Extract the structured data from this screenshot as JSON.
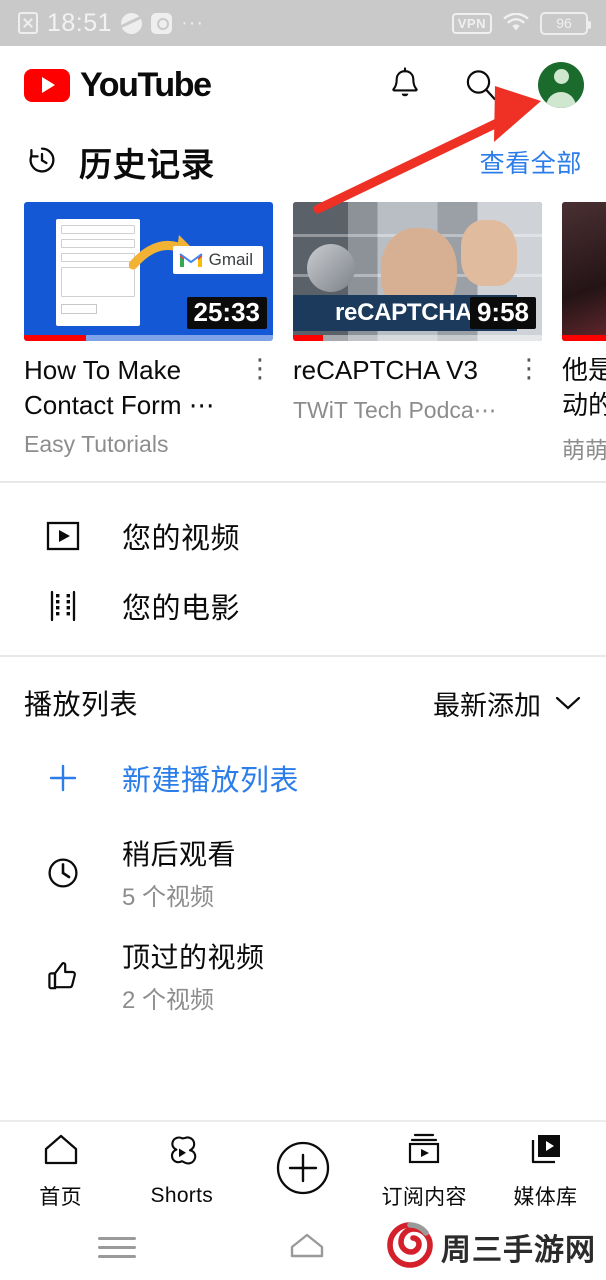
{
  "statusbar": {
    "time": "18:51",
    "close_icon": "close-icon",
    "app_icons": [
      "browser-app-icon",
      "tiktok-app-icon"
    ],
    "overflow": "···",
    "vpn_label": "VPN",
    "wifi_icon": "wifi-icon",
    "battery_level": "96"
  },
  "header": {
    "brand": "YouTube",
    "notifications_icon": "bell-icon",
    "search_icon": "search-icon",
    "avatar": "account-avatar",
    "avatar_color": "#1b6b2c"
  },
  "history": {
    "title": "历史记录",
    "clock_icon": "history-clock-icon",
    "view_all": "查看全部",
    "view_all_color": "#2b7de9",
    "videos": [
      {
        "title": "How To Make Contact Form ⋯",
        "channel": "Easy Tutorials",
        "duration": "25:33",
        "progress_percent": 25,
        "thumb_label": "Gmail",
        "menu_icon": "kebab-menu-icon"
      },
      {
        "title": "reCAPTCHA V3",
        "channel": "TWiT Tech Podca⋯",
        "duration": "9:58",
        "progress_percent": 12,
        "thumb_label": "reCAPTCHA V3",
        "menu_icon": "kebab-menu-icon"
      },
      {
        "title": "他是\n动的",
        "channel": "萌萌",
        "duration": "",
        "progress_percent": 100,
        "thumb_label": "",
        "menu_icon": "kebab-menu-icon"
      }
    ]
  },
  "menu": {
    "items": [
      {
        "label": "您的视频",
        "icon": "your-videos-icon"
      },
      {
        "label": "您的电影",
        "icon": "your-movies-icon"
      }
    ]
  },
  "playlists": {
    "title": "播放列表",
    "sort_label": "最新添加",
    "sort_icon": "chevron-down-icon",
    "new_playlist": {
      "label": "新建播放列表",
      "icon": "plus-icon",
      "color": "#2b7de9"
    },
    "items": [
      {
        "name": "稍后观看",
        "count": "5 个视频",
        "icon": "clock-icon"
      },
      {
        "name": "顶过的视频",
        "count": "2 个视频",
        "icon": "thumbs-up-icon"
      }
    ]
  },
  "bottom_nav": {
    "items": [
      {
        "label": "首页",
        "icon": "home-icon"
      },
      {
        "label": "Shorts",
        "icon": "shorts-icon"
      },
      {
        "label": "",
        "icon": "create-plus-icon"
      },
      {
        "label": "订阅内容",
        "icon": "subscriptions-icon"
      },
      {
        "label": "媒体库",
        "icon": "library-icon"
      }
    ]
  },
  "system_nav": {
    "menu_icon": "system-menu-icon",
    "home_icon": "system-home-icon",
    "watermark_text": "周三手游网",
    "watermark_icon": "spiral-logo-icon",
    "watermark_color": "#d4202a"
  },
  "annotation": {
    "arrow_icon": "red-arrow-annotation",
    "arrow_color": "#ee3124"
  }
}
